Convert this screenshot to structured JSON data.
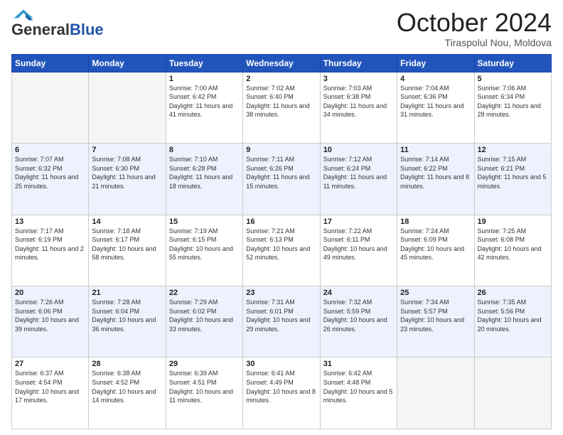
{
  "header": {
    "logo_general": "General",
    "logo_blue": "Blue",
    "month_title": "October 2024",
    "location": "Tiraspolul Nou, Moldova"
  },
  "days_of_week": [
    "Sunday",
    "Monday",
    "Tuesday",
    "Wednesday",
    "Thursday",
    "Friday",
    "Saturday"
  ],
  "weeks": [
    [
      {
        "day": "",
        "info": ""
      },
      {
        "day": "",
        "info": ""
      },
      {
        "day": "1",
        "info": "Sunrise: 7:00 AM\nSunset: 6:42 PM\nDaylight: 11 hours and 41 minutes."
      },
      {
        "day": "2",
        "info": "Sunrise: 7:02 AM\nSunset: 6:40 PM\nDaylight: 11 hours and 38 minutes."
      },
      {
        "day": "3",
        "info": "Sunrise: 7:03 AM\nSunset: 6:38 PM\nDaylight: 11 hours and 34 minutes."
      },
      {
        "day": "4",
        "info": "Sunrise: 7:04 AM\nSunset: 6:36 PM\nDaylight: 11 hours and 31 minutes."
      },
      {
        "day": "5",
        "info": "Sunrise: 7:06 AM\nSunset: 6:34 PM\nDaylight: 11 hours and 28 minutes."
      }
    ],
    [
      {
        "day": "6",
        "info": "Sunrise: 7:07 AM\nSunset: 6:32 PM\nDaylight: 11 hours and 25 minutes."
      },
      {
        "day": "7",
        "info": "Sunrise: 7:08 AM\nSunset: 6:30 PM\nDaylight: 11 hours and 21 minutes."
      },
      {
        "day": "8",
        "info": "Sunrise: 7:10 AM\nSunset: 6:28 PM\nDaylight: 11 hours and 18 minutes."
      },
      {
        "day": "9",
        "info": "Sunrise: 7:11 AM\nSunset: 6:26 PM\nDaylight: 11 hours and 15 minutes."
      },
      {
        "day": "10",
        "info": "Sunrise: 7:12 AM\nSunset: 6:24 PM\nDaylight: 11 hours and 11 minutes."
      },
      {
        "day": "11",
        "info": "Sunrise: 7:14 AM\nSunset: 6:22 PM\nDaylight: 11 hours and 8 minutes."
      },
      {
        "day": "12",
        "info": "Sunrise: 7:15 AM\nSunset: 6:21 PM\nDaylight: 11 hours and 5 minutes."
      }
    ],
    [
      {
        "day": "13",
        "info": "Sunrise: 7:17 AM\nSunset: 6:19 PM\nDaylight: 11 hours and 2 minutes."
      },
      {
        "day": "14",
        "info": "Sunrise: 7:18 AM\nSunset: 6:17 PM\nDaylight: 10 hours and 58 minutes."
      },
      {
        "day": "15",
        "info": "Sunrise: 7:19 AM\nSunset: 6:15 PM\nDaylight: 10 hours and 55 minutes."
      },
      {
        "day": "16",
        "info": "Sunrise: 7:21 AM\nSunset: 6:13 PM\nDaylight: 10 hours and 52 minutes."
      },
      {
        "day": "17",
        "info": "Sunrise: 7:22 AM\nSunset: 6:11 PM\nDaylight: 10 hours and 49 minutes."
      },
      {
        "day": "18",
        "info": "Sunrise: 7:24 AM\nSunset: 6:09 PM\nDaylight: 10 hours and 45 minutes."
      },
      {
        "day": "19",
        "info": "Sunrise: 7:25 AM\nSunset: 6:08 PM\nDaylight: 10 hours and 42 minutes."
      }
    ],
    [
      {
        "day": "20",
        "info": "Sunrise: 7:26 AM\nSunset: 6:06 PM\nDaylight: 10 hours and 39 minutes."
      },
      {
        "day": "21",
        "info": "Sunrise: 7:28 AM\nSunset: 6:04 PM\nDaylight: 10 hours and 36 minutes."
      },
      {
        "day": "22",
        "info": "Sunrise: 7:29 AM\nSunset: 6:02 PM\nDaylight: 10 hours and 33 minutes."
      },
      {
        "day": "23",
        "info": "Sunrise: 7:31 AM\nSunset: 6:01 PM\nDaylight: 10 hours and 29 minutes."
      },
      {
        "day": "24",
        "info": "Sunrise: 7:32 AM\nSunset: 5:59 PM\nDaylight: 10 hours and 26 minutes."
      },
      {
        "day": "25",
        "info": "Sunrise: 7:34 AM\nSunset: 5:57 PM\nDaylight: 10 hours and 23 minutes."
      },
      {
        "day": "26",
        "info": "Sunrise: 7:35 AM\nSunset: 5:56 PM\nDaylight: 10 hours and 20 minutes."
      }
    ],
    [
      {
        "day": "27",
        "info": "Sunrise: 6:37 AM\nSunset: 4:54 PM\nDaylight: 10 hours and 17 minutes."
      },
      {
        "day": "28",
        "info": "Sunrise: 6:38 AM\nSunset: 4:52 PM\nDaylight: 10 hours and 14 minutes."
      },
      {
        "day": "29",
        "info": "Sunrise: 6:39 AM\nSunset: 4:51 PM\nDaylight: 10 hours and 11 minutes."
      },
      {
        "day": "30",
        "info": "Sunrise: 6:41 AM\nSunset: 4:49 PM\nDaylight: 10 hours and 8 minutes."
      },
      {
        "day": "31",
        "info": "Sunrise: 6:42 AM\nSunset: 4:48 PM\nDaylight: 10 hours and 5 minutes."
      },
      {
        "day": "",
        "info": ""
      },
      {
        "day": "",
        "info": ""
      }
    ]
  ]
}
